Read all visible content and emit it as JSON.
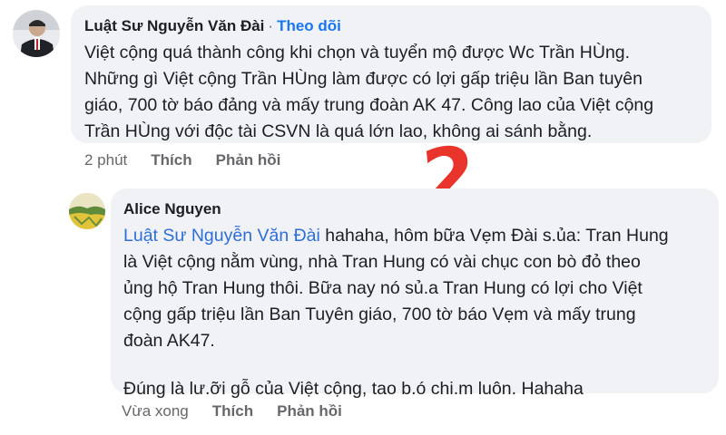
{
  "comments": [
    {
      "author": "Luật Sư Nguyễn Văn Đài",
      "separator": "·",
      "follow_label": "Theo dõi",
      "lines": [
        "Việt cộng quá thành công khi chọn và tuyển mộ được Wc Trần HÙng.",
        "Những gì Việt cộng Trần HÙng làm được có lợi gấp triệu lần Ban tuyên",
        "giáo, 700 tờ báo đảng và mấy trung đoàn AK 47. Công lao của Việt cộng",
        "Trần HÙng với độc tài CSVN là quá lớn lao, không ai sánh bằng."
      ],
      "timestamp": "2 phút",
      "like_label": "Thích",
      "reply_label": "Phản hồi"
    },
    {
      "author": "Alice Nguyen",
      "mention": "Luật Sư Nguyễn Văn Đài",
      "line1_rest": " hahaha, hôm bữa Vẹm Đài s.ủa: Tran Hung",
      "lines": [
        "là Việt cộng nằm vùng, nhà Tran Hung có vài chục con bò đỏ theo",
        "ủng hộ Tran Hung thôi.  Bữa nay nó sủ.a Tran Hung có lợi cho Việt",
        "cộng gấp triệu lần Ban Tuyên giáo, 700 tờ báo Vẹm và mấy trung",
        "đoàn AK47."
      ],
      "last_line": "Đúng là lư.ỡi gỗ của Việt cộng, tao b.ó chi.m luôn. Hahaha",
      "timestamp": "Vừa xong",
      "like_label": "Thích",
      "reply_label": "Phản hồi"
    }
  ],
  "annotation": "2"
}
